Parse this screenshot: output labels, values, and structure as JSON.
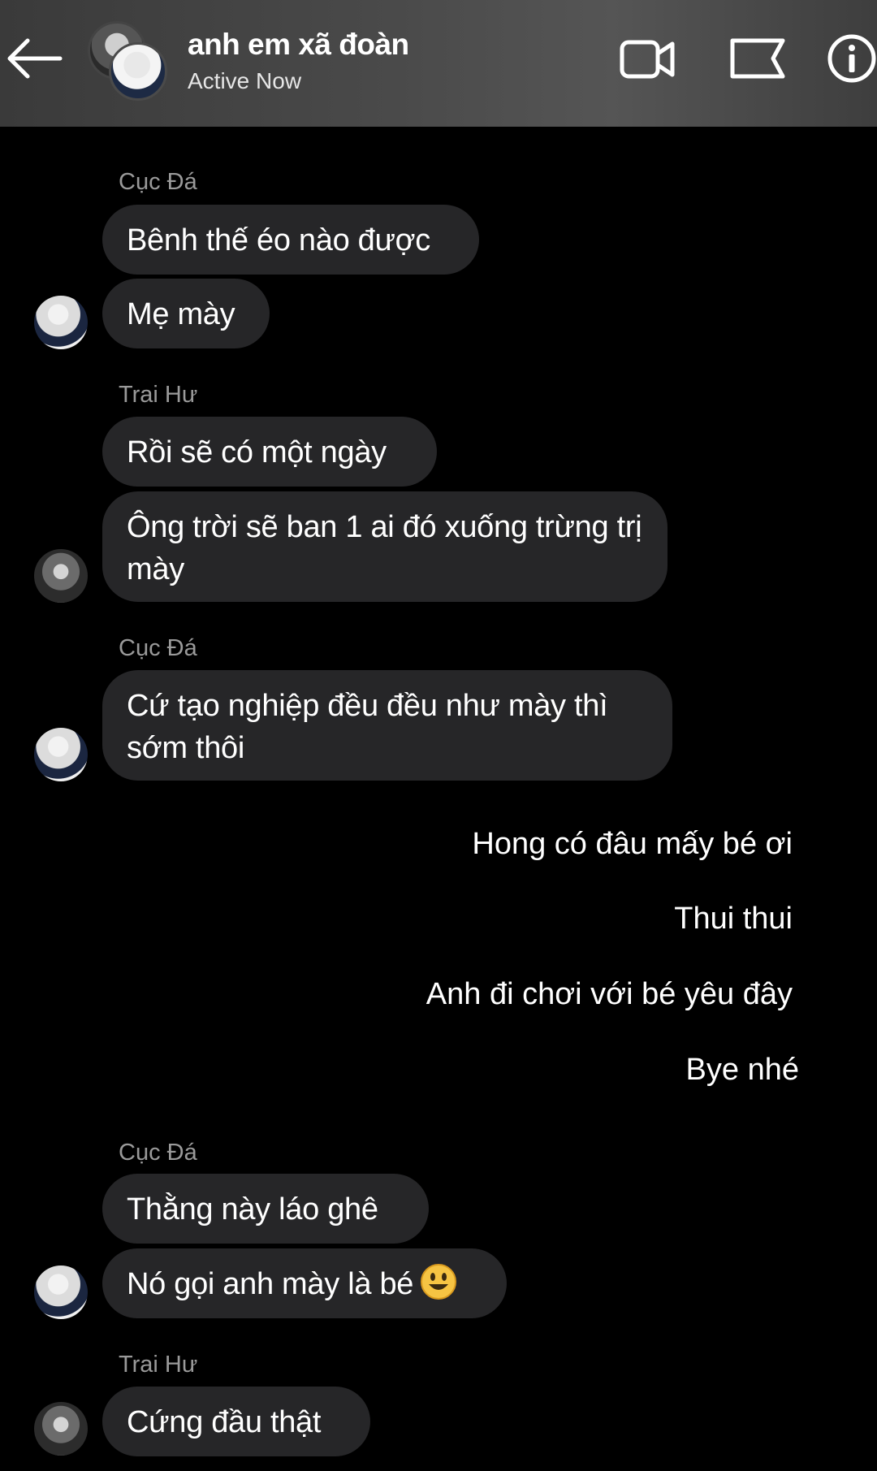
{
  "header": {
    "title": "anh em xã đoàn",
    "status": "Active Now",
    "icons": [
      "back-arrow-icon",
      "video-call-icon",
      "flag-icon",
      "info-icon"
    ]
  },
  "messages": [
    {
      "sender": "Cục Đá",
      "texts": [
        "Bênh thế éo nào được",
        "Mẹ mày"
      ]
    },
    {
      "sender": "Trai Hư",
      "texts": [
        "Rồi sẽ có một ngày",
        "Ông trời sẽ ban 1 ai đó xuống trừng trị mày"
      ]
    },
    {
      "sender": "Cục Đá",
      "texts": [
        "Cứ tạo nghiệp đều đều như mày thì sớm thôi"
      ]
    },
    {
      "sender": "me",
      "texts": [
        "Hong có đâu mấy bé ơi",
        "Thui thui",
        "Anh đi chơi với bé yêu đây",
        "Bye nhé"
      ]
    },
    {
      "sender": "Cục Đá",
      "texts": [
        "Thằng này láo ghê",
        "Nó gọi anh mày là bé"
      ]
    },
    {
      "sender": "Trai Hư",
      "texts": [
        "Cứng đầu thật"
      ]
    }
  ],
  "colors": {
    "background": "#000000",
    "bubble": "#262628",
    "sender_label": "#9a9a9a",
    "header": "#454545"
  }
}
